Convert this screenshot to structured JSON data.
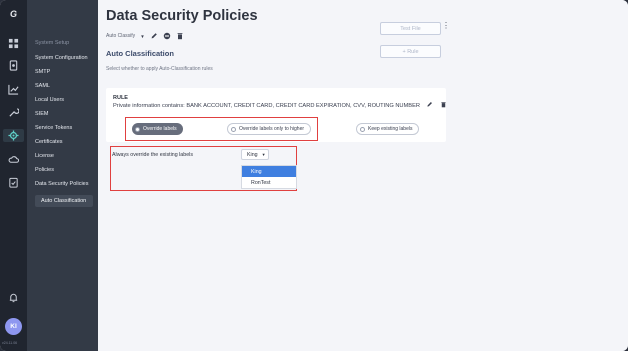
{
  "rail": {
    "logo": "G",
    "icons": [
      "grid-icon",
      "document-icon",
      "chart-icon",
      "wrench-icon",
      "clipboard-icon",
      "gear-icon",
      "cloud-icon",
      "clipboard-check-icon"
    ],
    "avatar": "KI",
    "version": "v24.11.06"
  },
  "nav": {
    "section": "System Setup",
    "items": [
      "System Configuration",
      "SMTP",
      "SAML",
      "Local Users",
      "SIEM",
      "Service Tokens",
      "Certificates",
      "License",
      "Policies",
      "Data Security Policies",
      "Auto Classification"
    ]
  },
  "header": {
    "title": "Data Security Policies",
    "mode": "Auto Classify",
    "test_file": "Test File",
    "add_rule": "+ Rule"
  },
  "section": {
    "title": "Auto Classification",
    "description": "Select whether to apply Auto-Classification rules"
  },
  "rule": {
    "heading": "RULE",
    "text": "Private information contains: BANK ACCOUNT, CREDIT CARD, CREDIT CARD EXPIRATION, CVV, ROUTING NUMBER"
  },
  "options": {
    "override": "Override labels",
    "higher": "Override labels only to higher",
    "keep": "Keep existing labels",
    "selected": "Override labels"
  },
  "override": {
    "label": "Always override the existing labels",
    "value": "King",
    "dropdown": [
      "King",
      "RonTest"
    ]
  },
  "colors": {
    "accent": "#3f7fe0",
    "highlight_border": "#e04040",
    "sidebar": "#333a46",
    "rail": "#20252f",
    "avatar": "#8e97f0"
  }
}
